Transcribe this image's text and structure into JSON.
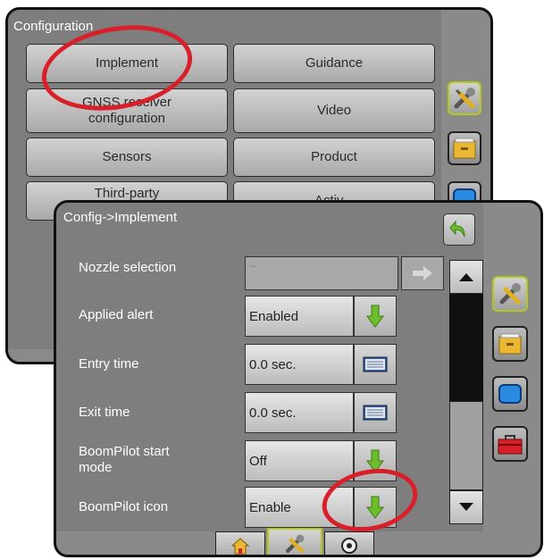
{
  "back_screen": {
    "title": "Configuration",
    "buttons": [
      "Implement",
      "Guidance",
      "GNSS receiver configuration",
      "Video",
      "Sensors",
      "Product",
      "Third-party",
      "Activ..."
    ]
  },
  "front_screen": {
    "title": "Config->Implement",
    "rows": [
      {
        "label": "Nozzle selection",
        "value": "--"
      },
      {
        "label": "Applied alert",
        "value": "Enabled"
      },
      {
        "label": "Entry time",
        "value": "0.0 sec."
      },
      {
        "label": "Exit time",
        "value": "0.0 sec."
      },
      {
        "label": "BoomPilot start mode",
        "value": "Off"
      },
      {
        "label": "BoomPilot icon",
        "value": "Enable"
      }
    ]
  },
  "colors": {
    "panel": "#8a8a8a",
    "highlight_circle": "#d9202a",
    "down_arrow": "#6cbf2a",
    "back_arrow": "#6cbf2a",
    "active_tab_border": "#b6c81e"
  },
  "icons": {
    "back": "back-arrow-icon",
    "tools": "wrench-screwdriver-icon",
    "folder": "file-drawer-icon",
    "screen": "blue-screen-icon",
    "toolbox": "red-toolbox-icon",
    "home": "home-icon",
    "gauge": "gauge-icon",
    "keyboard": "keyboard-icon",
    "next": "right-arrow-icon"
  }
}
